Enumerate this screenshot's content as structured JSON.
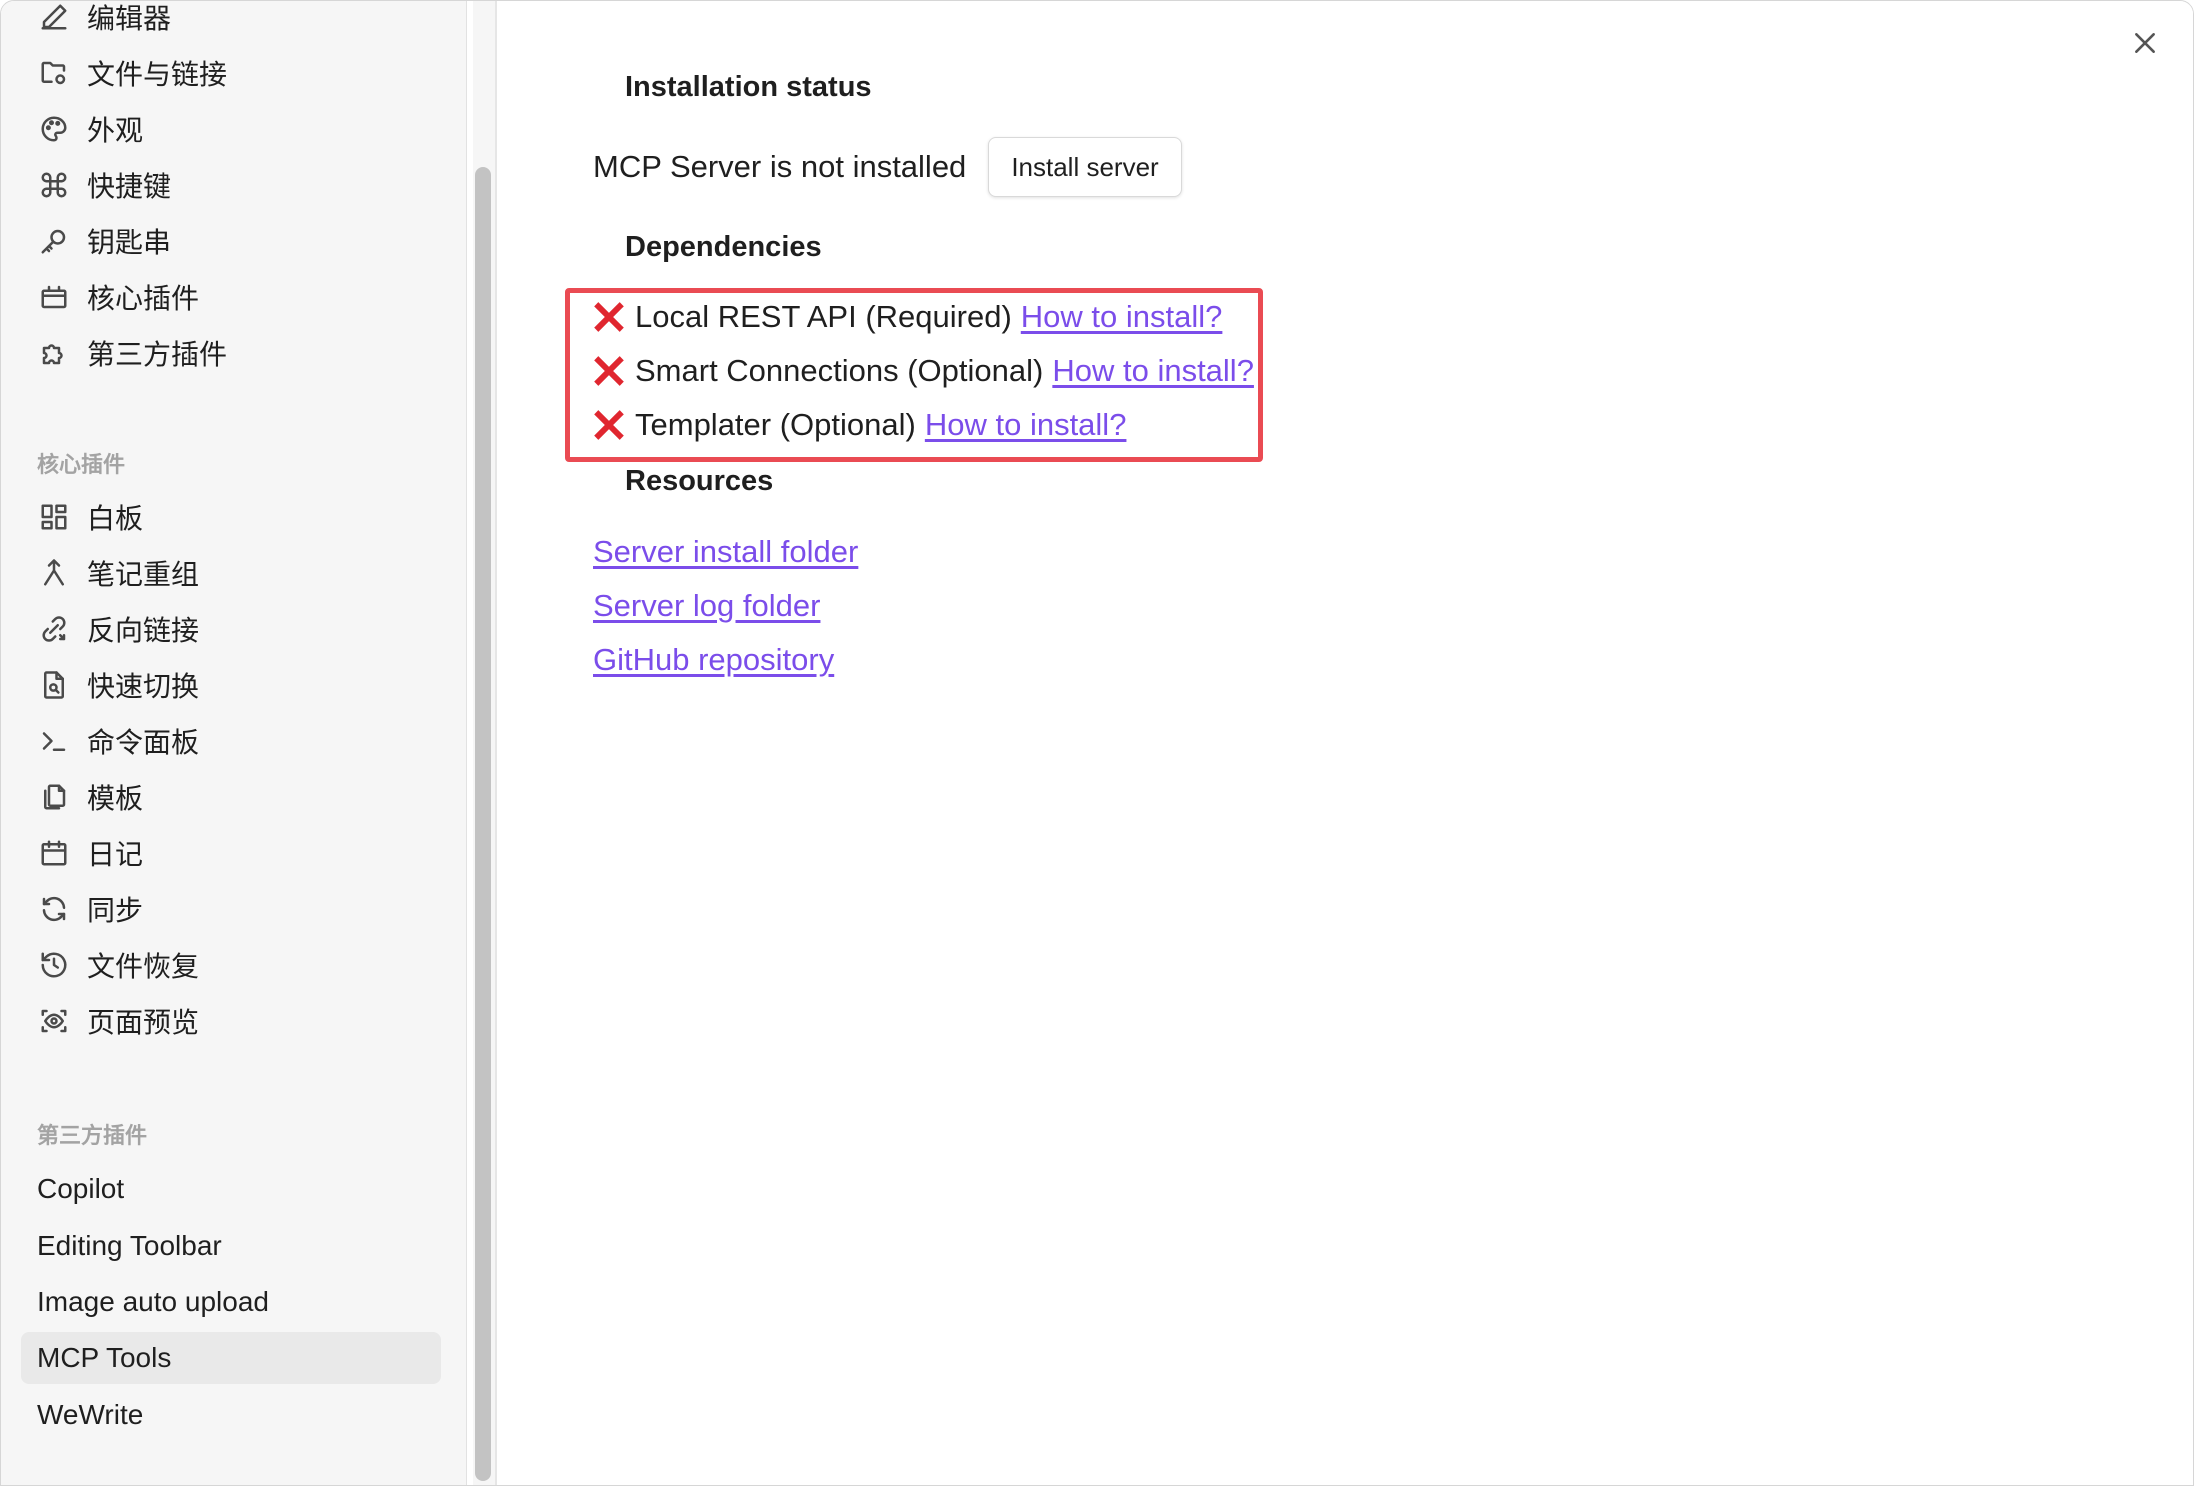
{
  "sidebar": {
    "options_items": [
      {
        "label": "编辑器",
        "icon": "pencil-icon"
      },
      {
        "label": "文件与链接",
        "icon": "folder-gear-icon"
      },
      {
        "label": "外观",
        "icon": "palette-icon"
      },
      {
        "label": "快捷键",
        "icon": "command-icon"
      },
      {
        "label": "钥匙串",
        "icon": "key-icon"
      },
      {
        "label": "核心插件",
        "icon": "briefcase-icon"
      },
      {
        "label": "第三方插件",
        "icon": "puzzle-icon"
      }
    ],
    "core_header": "核心插件",
    "core_items": [
      {
        "label": "白板",
        "icon": "grid-icon"
      },
      {
        "label": "笔记重组",
        "icon": "merge-icon"
      },
      {
        "label": "反向链接",
        "icon": "backlink-icon"
      },
      {
        "label": "快速切换",
        "icon": "file-search-icon"
      },
      {
        "label": "命令面板",
        "icon": "terminal-icon"
      },
      {
        "label": "模板",
        "icon": "copy-icon"
      },
      {
        "label": "日记",
        "icon": "calendar-icon"
      },
      {
        "label": "同步",
        "icon": "sync-icon"
      },
      {
        "label": "文件恢复",
        "icon": "history-icon"
      },
      {
        "label": "页面预览",
        "icon": "preview-icon"
      }
    ],
    "community_header": "第三方插件",
    "community_items": [
      {
        "label": "Copilot"
      },
      {
        "label": "Editing Toolbar"
      },
      {
        "label": "Image auto upload"
      },
      {
        "label": "MCP Tools",
        "active": true
      },
      {
        "label": "WeWrite"
      }
    ]
  },
  "main": {
    "installation_heading": "Installation status",
    "status_text": "MCP Server is not installed",
    "install_button": "Install server",
    "dependencies_heading": "Dependencies",
    "dependencies": [
      {
        "label": "Local REST API (Required)",
        "link": "How to install?",
        "status": "missing"
      },
      {
        "label": "Smart Connections (Optional)",
        "link": "How to install?",
        "status": "missing"
      },
      {
        "label": "Templater (Optional)",
        "link": "How to install?",
        "status": "missing"
      }
    ],
    "resources_heading": "Resources",
    "resources": [
      {
        "label": "Server install folder"
      },
      {
        "label": "Server log folder"
      },
      {
        "label": "GitHub repository"
      }
    ]
  },
  "colors": {
    "link": "#7b4dea",
    "error_x": "#e0262f",
    "highlight_box": "#ea4b53",
    "active_item_bg": "#e9e9e9"
  }
}
